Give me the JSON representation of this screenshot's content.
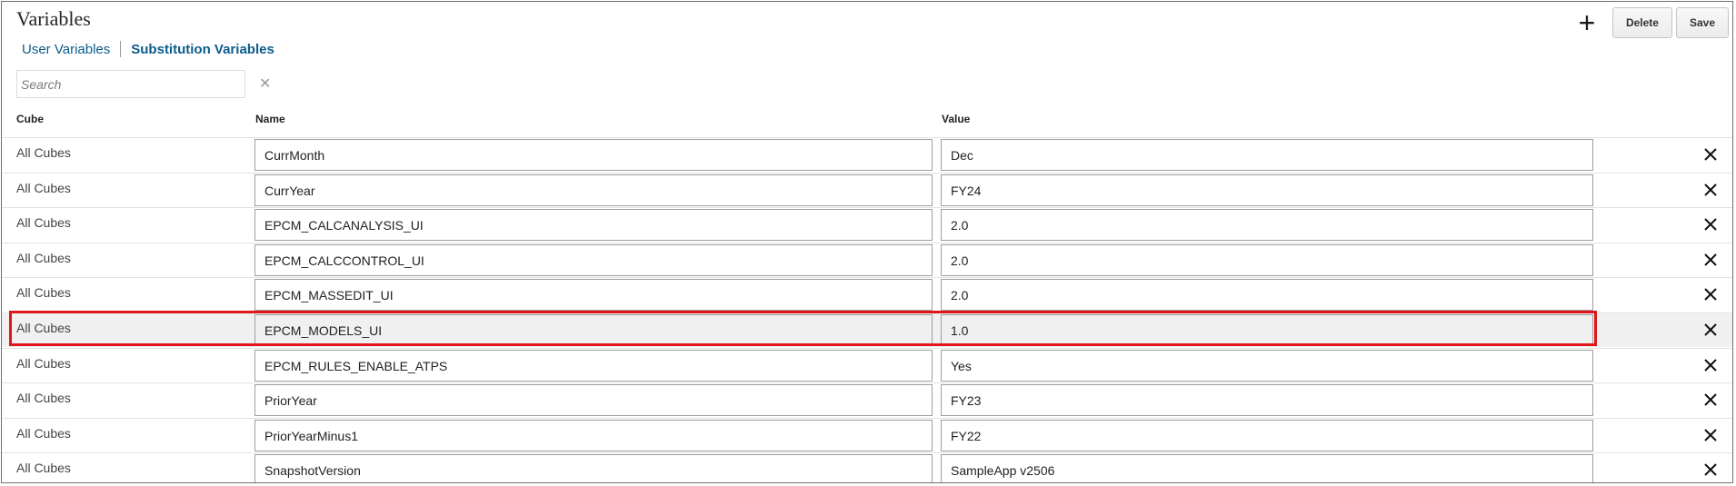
{
  "page": {
    "title": "Variables"
  },
  "toolbar": {
    "add_icon": "plus-icon",
    "delete_label": "Delete",
    "save_label": "Save"
  },
  "tabs": [
    {
      "label": "User Variables",
      "active": false
    },
    {
      "label": "Substitution Variables",
      "active": true
    }
  ],
  "search": {
    "placeholder": "Search",
    "value": "",
    "clear_icon": "close-icon"
  },
  "columns": {
    "cube": "Cube",
    "name": "Name",
    "value": "Value"
  },
  "rows": [
    {
      "cube": "All Cubes",
      "name": "CurrMonth",
      "value": "Dec",
      "selected": false
    },
    {
      "cube": "All Cubes",
      "name": "CurrYear",
      "value": "FY24",
      "selected": false
    },
    {
      "cube": "All Cubes",
      "name": "EPCM_CALCANALYSIS_UI",
      "value": "2.0",
      "selected": false
    },
    {
      "cube": "All Cubes",
      "name": "EPCM_CALCCONTROL_UI",
      "value": "2.0",
      "selected": false
    },
    {
      "cube": "All Cubes",
      "name": "EPCM_MASSEDIT_UI",
      "value": "2.0",
      "selected": false
    },
    {
      "cube": "All Cubes",
      "name": "EPCM_MODELS_UI",
      "value": "1.0",
      "selected": true
    },
    {
      "cube": "All Cubes",
      "name": "EPCM_RULES_ENABLE_ATPS",
      "value": "Yes",
      "selected": false
    },
    {
      "cube": "All Cubes",
      "name": "PriorYear",
      "value": "FY23",
      "selected": false
    },
    {
      "cube": "All Cubes",
      "name": "PriorYearMinus1",
      "value": "FY22",
      "selected": false
    },
    {
      "cube": "All Cubes",
      "name": "SnapshotVersion",
      "value": "SampleApp v2506",
      "selected": false
    }
  ],
  "colors": {
    "link": "#0b5c8c",
    "highlight_border": "#e1161c",
    "selected_row": "#f0f0f0"
  }
}
